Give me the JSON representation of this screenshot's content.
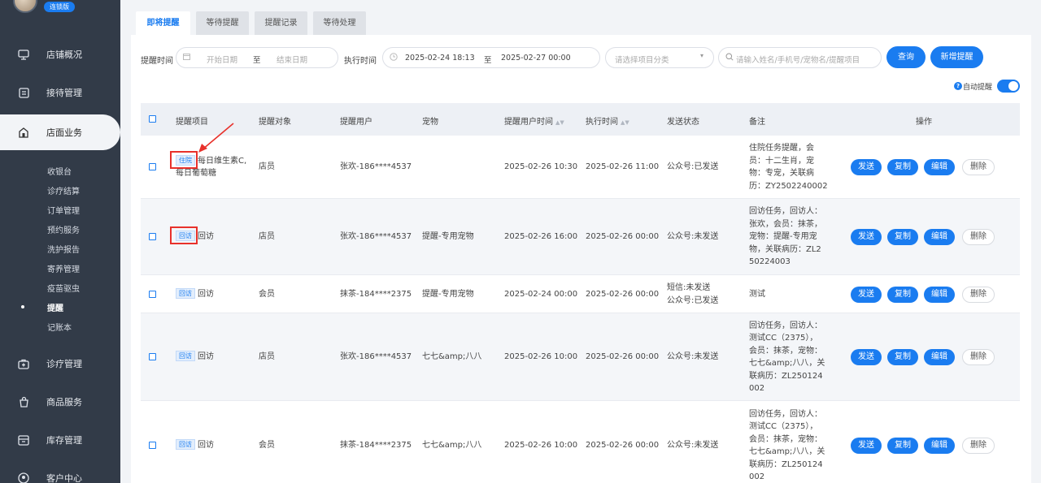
{
  "sidebar": {
    "badge": "连锁版",
    "nav": [
      {
        "label": "店铺概况",
        "icon": "monitor-icon"
      },
      {
        "label": "接待管理",
        "icon": "clipboard-icon"
      },
      {
        "label": "店面业务",
        "icon": "store-icon"
      },
      {
        "label": "诊疗管理",
        "icon": "medical-kit-icon"
      },
      {
        "label": "商品服务",
        "icon": "bag-icon"
      },
      {
        "label": "库存管理",
        "icon": "inventory-icon"
      },
      {
        "label": "客户中心",
        "icon": "user-circle-icon"
      }
    ],
    "sub": [
      "收银台",
      "诊疗结算",
      "订单管理",
      "预约服务",
      "洗护报告",
      "寄养管理",
      "疫苗驱虫",
      "提醒",
      "记账本"
    ]
  },
  "tabs": [
    "即将提醒",
    "等待提醒",
    "提醒记录",
    "等待处理"
  ],
  "filters": {
    "remind_time_label": "提醒时间",
    "start_placeholder": "开始日期",
    "to1": "至",
    "end_placeholder": "结束日期",
    "exec_time_label": "执行时间",
    "exec_start": "2025-02-24 18:13",
    "to2": "至",
    "exec_end": "2025-02-27 00:00",
    "category_placeholder": "请选择项目分类",
    "search_placeholder": "请输入姓名/手机号/宠物名/提醒项目",
    "query_btn": "查询",
    "add_btn": "新增提醒",
    "auto_label": "自动提醒",
    "auto_enabled": true
  },
  "table": {
    "headers": [
      "提醒项目",
      "提醒对象",
      "提醒用户",
      "宠物",
      "提醒用户时间",
      "执行时间",
      "发送状态",
      "备注",
      "操作"
    ],
    "actions": {
      "send": "发送",
      "copy": "复制",
      "edit": "编辑",
      "delete": "删除"
    },
    "rows": [
      {
        "tag": "住院",
        "item": [
          "每日维生素C,",
          "每日葡萄糖"
        ],
        "target": "店员",
        "user": "张欢-186****4537",
        "pet": "",
        "remind_time": "2025-02-26 10:30",
        "exec_time": "2025-02-26 11:00",
        "status": [
          "公众号:已发送"
        ],
        "note": [
          "住院任务提醒，会",
          "员：十二生肖，宠",
          "物：专宠，关联病",
          "历：ZY2502240002"
        ]
      },
      {
        "tag": "回访",
        "item": [
          "回访"
        ],
        "target": "店员",
        "user": "张欢-186****4537",
        "pet": "提醒-专用宠物",
        "remind_time": "2025-02-26 16:00",
        "exec_time": "2025-02-26 00:00",
        "status": [
          "公众号:未发送"
        ],
        "note": [
          "回访任务，回访人：",
          "张欢，会员：抹茶，",
          "宠物：提醒-专用宠",
          "物，关联病历：ZL2",
          "50224003"
        ]
      },
      {
        "tag": "回访",
        "item": [
          "回访"
        ],
        "target": "会员",
        "user": "抹茶-184****2375",
        "pet": "提醒-专用宠物",
        "remind_time": "2025-02-24 00:00",
        "exec_time": "2025-02-26 00:00",
        "status": [
          "短信:未发送",
          "公众号:已发送"
        ],
        "note": [
          "测试"
        ]
      },
      {
        "tag": "回访",
        "item": [
          "回访"
        ],
        "target": "店员",
        "user": "张欢-186****4537",
        "pet": "七七&amp;八八",
        "remind_time": "2025-02-26 10:00",
        "exec_time": "2025-02-26 00:00",
        "status": [
          "公众号:未发送"
        ],
        "note": [
          "回访任务，回访人：",
          "测试CC（2375），",
          "会员：抹茶，宠物：",
          "七七&amp;八八，关",
          "联病历：ZL250124",
          "002"
        ]
      },
      {
        "tag": "回访",
        "item": [
          "回访"
        ],
        "target": "会员",
        "user": "抹茶-184****2375",
        "pet": "七七&amp;八八",
        "remind_time": "2025-02-26 10:00",
        "exec_time": "2025-02-26 00:00",
        "status": [
          "公众号:未发送"
        ],
        "note": [
          "回访任务，回访人：",
          "测试CC（2375），",
          "会员：抹茶，宠物：",
          "七七&amp;八八，关",
          "联病历：ZL250124",
          "002"
        ]
      }
    ]
  }
}
